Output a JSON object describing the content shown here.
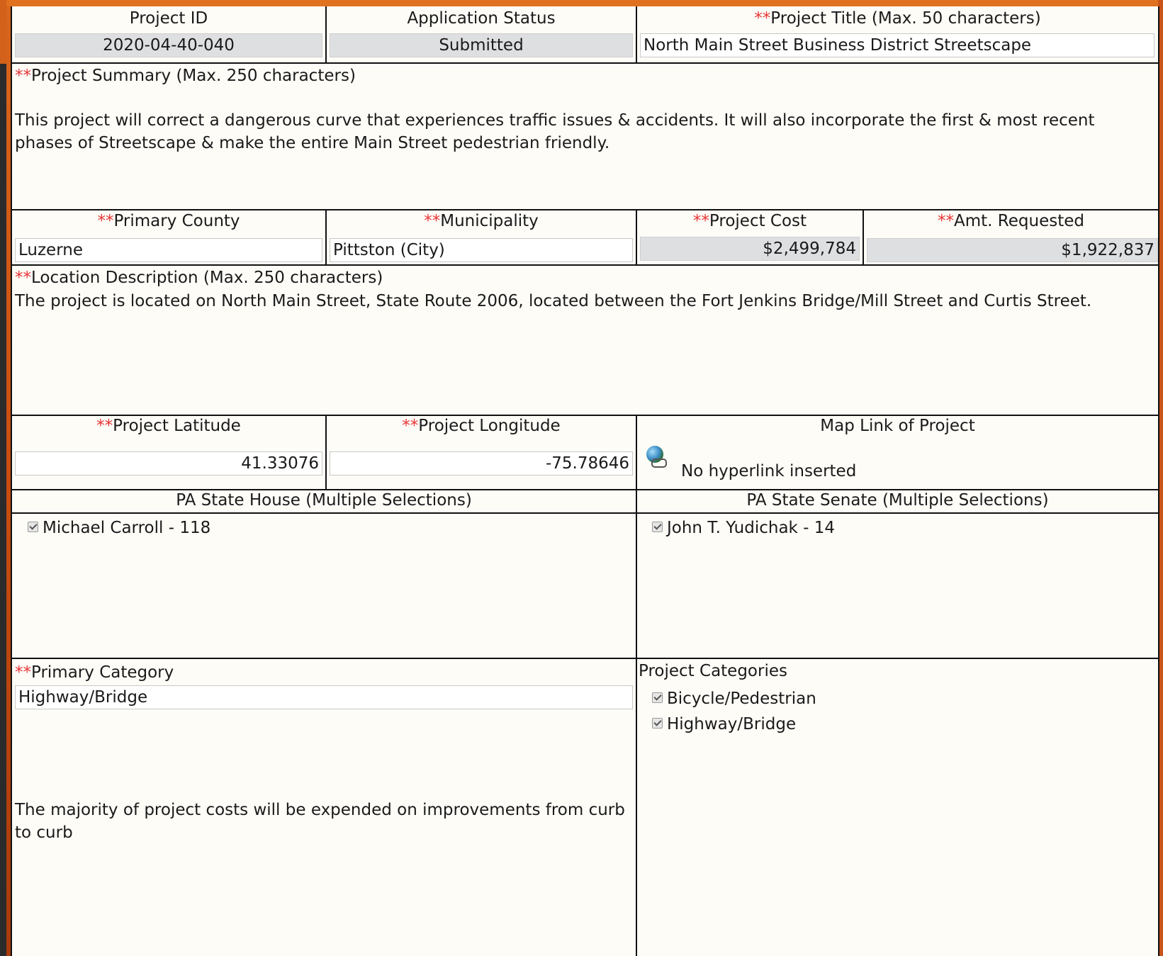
{
  "header": {
    "project_id_label": "Project ID",
    "project_id": "2020-04-40-040",
    "status_label": "Application Status",
    "status": "Submitted",
    "title_req": "**",
    "title_label": "Project Title (Max. 50 characters)",
    "title": "North Main Street Business District Streetscape"
  },
  "summary": {
    "req": "**",
    "label": "Project Summary (Max. 250 characters)",
    "text": "This project will correct a dangerous curve that experiences traffic issues & accidents. It will also incorporate the first & most recent phases of Streetscape & make the entire Main Street pedestrian friendly."
  },
  "location_row": {
    "county_req": "**",
    "county_label": "Primary County",
    "county": "Luzerne",
    "municipality_req": "**",
    "municipality_label": "Municipality",
    "municipality": "Pittston (City)",
    "cost_req": "**",
    "cost_label": "Project Cost",
    "cost": "$2,499,784",
    "requested_req": "**",
    "requested_label": "Amt. Requested",
    "requested": "$1,922,837"
  },
  "location_description": {
    "req": "**",
    "label": "Location Description (Max. 250 characters)",
    "text": "The project is located on North Main Street, State Route 2006, located between the Fort Jenkins Bridge/Mill Street and Curtis Street."
  },
  "coordinates": {
    "lat_req": "**",
    "lat_label": "Project Latitude",
    "lat": "41.33076",
    "lon_req": "**",
    "lon_label": "Project Longitude",
    "lon": "-75.78646",
    "map_label": "Map Link of Project",
    "map_icon": "globe-link-icon",
    "map_value": "No hyperlink inserted"
  },
  "legislators": {
    "house_label": "PA State House (Multiple Selections)",
    "house": [
      "Michael Carroll - 118"
    ],
    "senate_label": "PA State Senate (Multiple Selections)",
    "senate": [
      "John T. Yudichak - 14"
    ]
  },
  "categories": {
    "primary_req": "**",
    "primary_label": "Primary Category",
    "primary": "Highway/Bridge",
    "note": "The majority of project costs will be expended on improvements from curb to curb",
    "list_label": "Project Categories",
    "list": [
      "Bicycle/Pedestrian",
      "Highway/Bridge"
    ]
  },
  "colors": {
    "required_marker": "#e53535",
    "readonly_field": "#dedfe1",
    "frame": "#d9661c"
  }
}
